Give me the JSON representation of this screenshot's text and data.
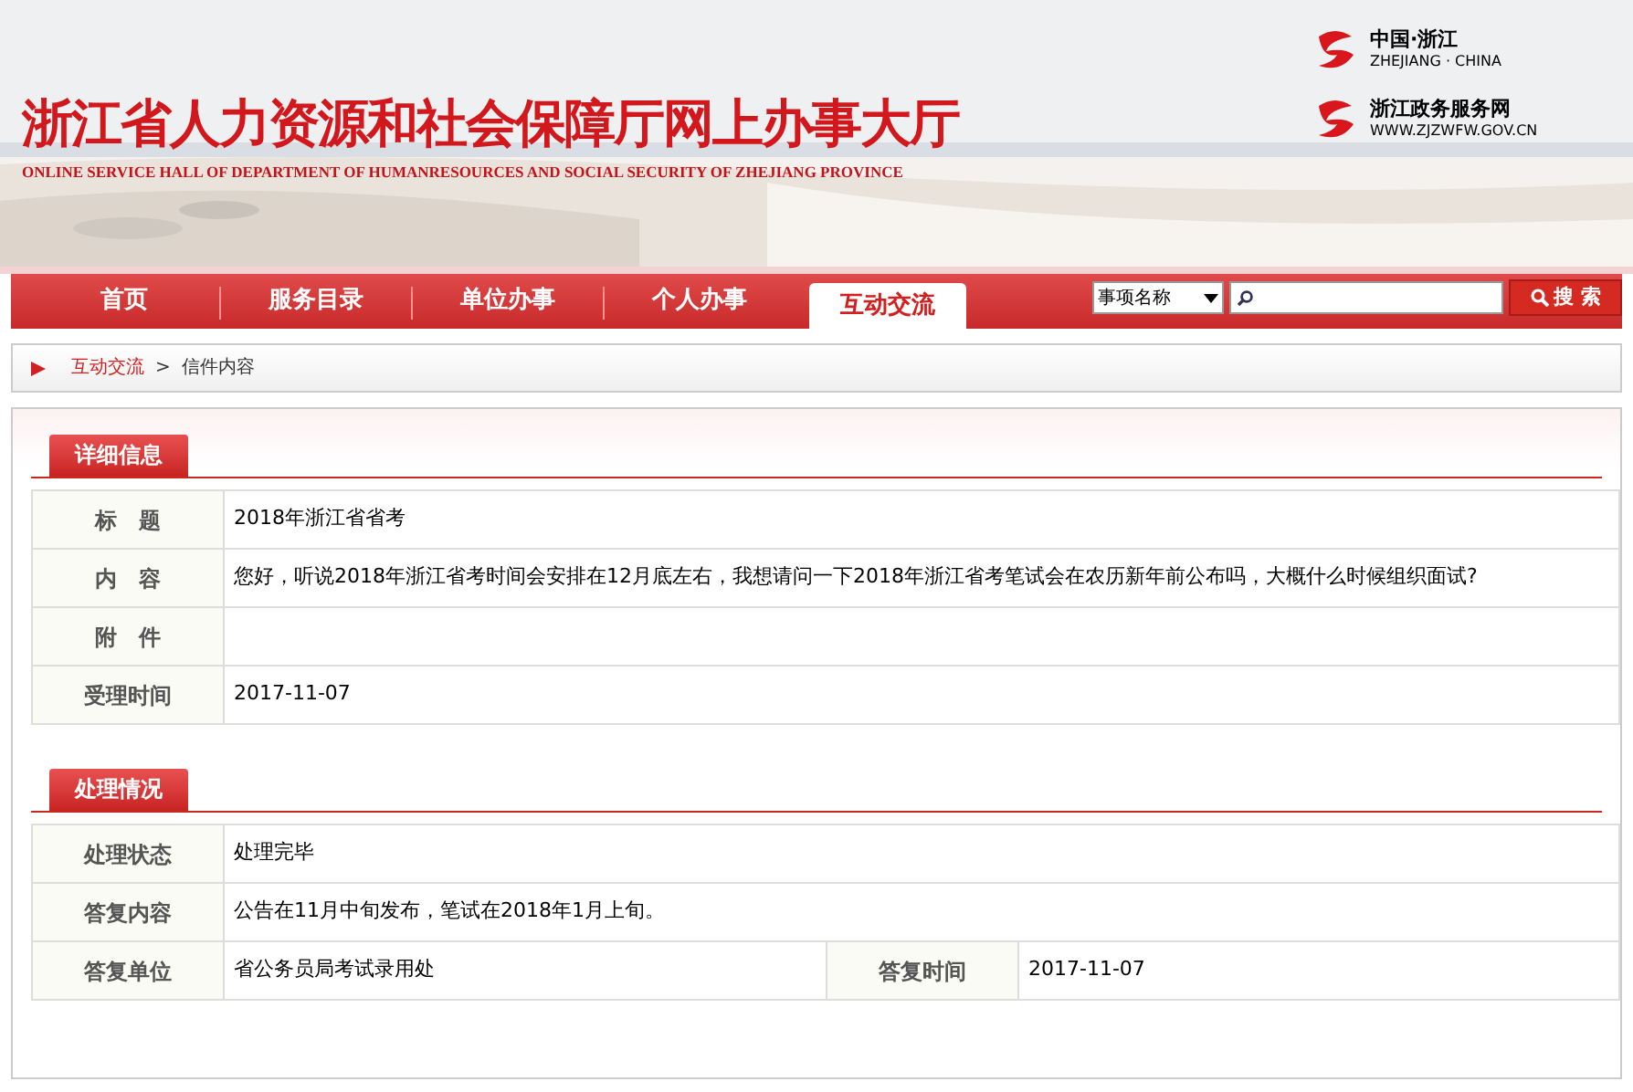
{
  "header": {
    "title": "浙江省人力资源和社会保障厅网上办事大厅",
    "subtitle": "ONLINE SERVICE HALL OF DEPARTMENT OF HUMANRESOURCES AND SOCIAL SECURITY OF ZHEJIANG PROVINCE",
    "logos": [
      {
        "title": "中国·浙江",
        "subtitle": "ZHEJIANG · CHINA"
      },
      {
        "title": "浙江政务服务网",
        "subtitle": "WWW.ZJZWFW.GOV.CN"
      }
    ]
  },
  "nav": [
    {
      "label": "首页",
      "selected": false
    },
    {
      "label": "服务目录",
      "selected": false
    },
    {
      "label": "单位办事",
      "selected": false
    },
    {
      "label": "个人办事",
      "selected": false
    },
    {
      "label": "互动交流",
      "selected": true
    }
  ],
  "search": {
    "select_value": "事项名称",
    "button": "搜 索"
  },
  "breadcrumb": {
    "link": "互动交流",
    "separator": ">",
    "current": "信件内容"
  },
  "sections": [
    {
      "title": "详细信息",
      "rows": [
        {
          "cells": [
            {
              "label": "标　题",
              "value": "2018年浙江省省考"
            }
          ]
        },
        {
          "cells": [
            {
              "label": "内　容",
              "value": "您好，听说2018年浙江省考时间会安排在12月底左右，我想请问一下2018年浙江省考笔试会在农历新年前公布吗，大概什么时候组织面试?"
            }
          ]
        },
        {
          "cells": [
            {
              "label": "附　件"
            }
          ]
        },
        {
          "cells": [
            {
              "label": "受理时间",
              "value": "2017-11-07"
            }
          ]
        }
      ]
    },
    {
      "title": "处理情况",
      "rows": [
        {
          "cells": [
            {
              "label": "处理状态",
              "value": "处理完毕"
            }
          ]
        },
        {
          "cells": [
            {
              "label": "答复内容",
              "value": "公告在11月中旬发布，笔试在2018年1月上旬。"
            }
          ]
        },
        {
          "cells": [
            {
              "label": "答复单位",
              "value": "省公务员局考试录用处"
            },
            {
              "label": "答复时间",
              "value": "2017-11-07"
            }
          ]
        }
      ]
    }
  ]
}
